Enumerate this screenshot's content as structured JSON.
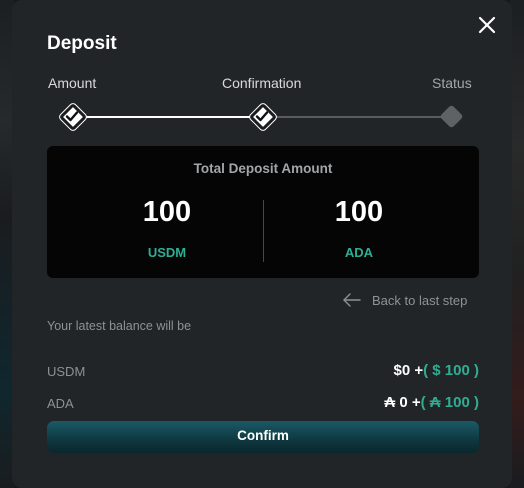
{
  "modal": {
    "title": "Deposit",
    "close_icon": "close-icon"
  },
  "steps": [
    {
      "label": "Amount",
      "state": "done"
    },
    {
      "label": "Confirmation",
      "state": "done"
    },
    {
      "label": "Status",
      "state": "pending"
    }
  ],
  "summary": {
    "title": "Total Deposit Amount",
    "left": {
      "amount": "100",
      "unit": "USDM"
    },
    "right": {
      "amount": "100",
      "unit": "ADA"
    }
  },
  "back_link": {
    "label": "Back to last step",
    "icon": "arrow-left-icon"
  },
  "balance": {
    "note": "Your latest balance will be",
    "rows": [
      {
        "name": "USDM",
        "current": "$0 +",
        "addition": "( $ 100 )"
      },
      {
        "name": "ADA",
        "current": "₳ 0 +",
        "addition": "( ₳ 100 )"
      }
    ]
  },
  "confirm_button": {
    "label": "Confirm"
  },
  "colors": {
    "accent": "#2fae94",
    "modal_bg": "#222527",
    "box_bg": "#050505",
    "button_from": "#1b5a66",
    "button_to": "#0a262c"
  }
}
